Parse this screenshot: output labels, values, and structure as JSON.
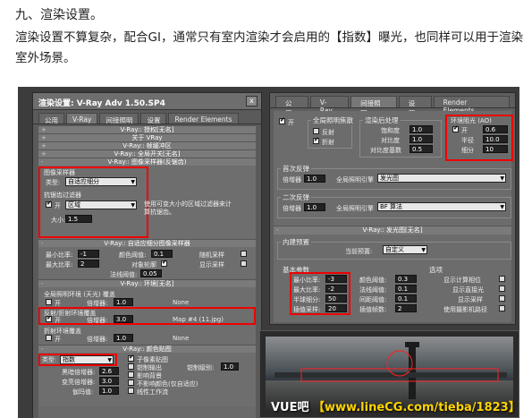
{
  "article": {
    "heading": "九、渲染设置。",
    "paragraph": "渲染设置不算复杂，配合GI，通常只有室内渲染才会启用的【指数】曝光，也同样可以用于渲染室外场景。"
  },
  "left_window": {
    "title": "渲染设置: V-Ray Adv 1.50.SP4",
    "close": "x",
    "tabs": [
      "公用",
      "V-Ray",
      "间接照明",
      "设置",
      "Render Elements"
    ],
    "rollouts": {
      "authorization": "V-Ray:: 授权[无名]",
      "about": "关于 VRay",
      "framebuffer": "V-Ray:: 帧缓冲区",
      "global_switches": "V-Ray:: 全局开关[无名]",
      "image_sampler": "V-Ray:: 图像采样器(反锯齿)",
      "adaptive_subdiv": "V-Ray:: 自适应细分图像采样器",
      "environment": "V-Ray:: 环境[无名]",
      "color_mapping": "V-Ray:: 颜色贴图"
    },
    "image_sampler": {
      "group_label": "图像采样器",
      "type_label": "类型:",
      "type_value": "自适应细分",
      "aa_filter_label": "抗锯齿过滤器",
      "on_label": "开",
      "filter_value": "区域",
      "filter_desc": "使用可变大小的区域过滤器来计算抗锯齿。",
      "size_label": "大小:",
      "size_value": "1.5"
    },
    "adaptive": {
      "min_rate_label": "最小比率:",
      "min_rate": "-1",
      "max_rate_label": "最大比率:",
      "max_rate": "2",
      "clr_thresh_label": "颜色阈值:",
      "clr_thresh": "0.1",
      "object_outline_label": "对象轮廓",
      "rand_label": "随机采样",
      "show_samples_label": "显示采样",
      "normals_label": "法线阈值:",
      "normals": "0.05"
    },
    "environment": {
      "gi_env_label": "全局照明环境 (天光) 覆盖",
      "on_label": "开",
      "multiplier_label": "倍增器:",
      "multiplier": "1.0",
      "none": "None",
      "refl_label": "反射/折射环境覆盖",
      "refl_multiplier": "3.0",
      "refl_map": "Map #4 (11.jpg)",
      "refr_label": "折射环境覆盖",
      "refr_multiplier": "1.0"
    },
    "color_map": {
      "type_label": "类型:",
      "type_value": "指数",
      "dark_label": "黑暗倍增器:",
      "dark": "2.6",
      "bright_label": "变亮倍增器:",
      "bright": "3.0",
      "gamma_label": "伽玛值:",
      "gamma": "1.0",
      "opt1": "子像素贴图",
      "opt2": "钳制输出",
      "opt3": "影响背景",
      "opt4": "不影响颜色(仅自适应)",
      "opt5": "线性工作流",
      "clamp_label": "钳制级别:",
      "clamp": "1.0"
    }
  },
  "right_window": {
    "tabs": [
      "公用",
      "V-Ray",
      "间接照明",
      "设置",
      "Render Elements"
    ],
    "gi": {
      "on_label": "开",
      "caustics_title": "全局照明焦散",
      "reflective": "反射",
      "refractive": "折射",
      "post_title": "渲染后处理",
      "saturation_label": "饱和度",
      "saturation": "1.0",
      "contrast_label": "对比度",
      "contrast": "1.0",
      "contrast_base_label": "对比度基数",
      "contrast_base": "0.5",
      "ao_title": "环境阻光 (AO)",
      "ao_on": "开",
      "ao_amount": "0.6",
      "radius_label": "半径",
      "radius": "10.0",
      "subdivs_label": "细分",
      "subdivs": "10",
      "primary_title": "首次反弹",
      "mult_label": "倍增器",
      "primary_mult": "1.0",
      "primary_engine_label": "全局照明引擎",
      "primary_engine": "发光图",
      "secondary_title": "二次反弹",
      "secondary_mult": "1.0",
      "secondary_engine": "BF 算法"
    },
    "irradiance_roll": "V-Ray:: 发光图[无名]",
    "presets_title": "内建预置",
    "current_preset_label": "当前预置:",
    "current_preset": "自定义",
    "basic_title": "基本参数",
    "min_rate_label": "最小比率:",
    "min_rate": "-3",
    "max_rate_label": "最大比率:",
    "max_rate": "-2",
    "hsph_label": "半球细分:",
    "hsph": "50",
    "interp_label": "插值采样:",
    "interp": "20",
    "clr_label": "颜色阈值:",
    "clr": "0.3",
    "nrm_label": "法线阈值:",
    "nrm": "0.1",
    "dist_label": "间距阈值:",
    "dist": "0.1",
    "interp_frames_label": "插值帧数:",
    "interp_frames": "2",
    "options_title": "选项",
    "opt_show_calc": "显示计算相位",
    "opt_show_direct": "显示直接光",
    "opt_show_samples": "显示采样",
    "opt_use_camera": "使用摄影机路径"
  },
  "watermark": {
    "prefix": "VUE吧",
    "url": "【www.lineCG.com/tieba/1823】"
  }
}
